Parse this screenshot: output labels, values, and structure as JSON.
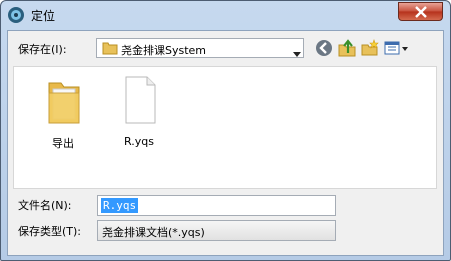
{
  "window": {
    "title": "定位"
  },
  "save_in": {
    "label": "保存在(I):",
    "value": "尧金排课System"
  },
  "files": [
    {
      "name": "导出",
      "icon": "folder-icon"
    },
    {
      "name": "R.yqs",
      "icon": "document-icon"
    }
  ],
  "file_name": {
    "label": "文件名(N):",
    "value": "R.yqs"
  },
  "save_type": {
    "label": "保存类型(T):",
    "value": "尧金排课文档(*.yqs)"
  },
  "toolbar": {
    "icons": [
      "back-icon",
      "up-folder-icon",
      "new-folder-icon",
      "view-menu-icon"
    ]
  }
}
